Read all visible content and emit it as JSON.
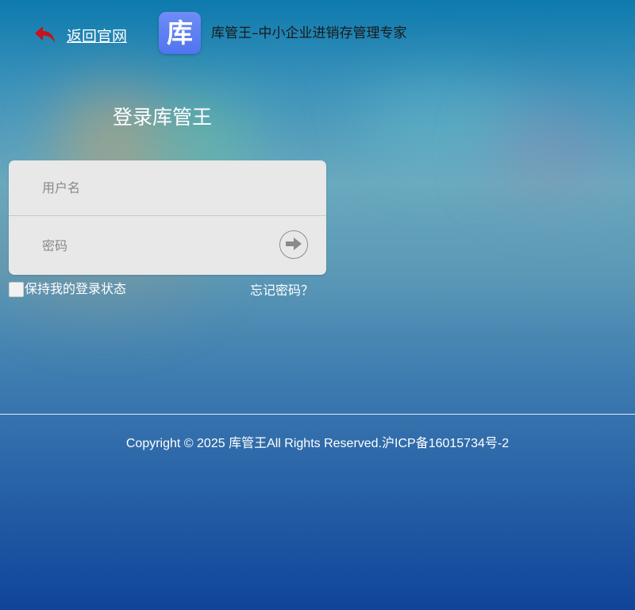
{
  "header": {
    "back_label": "返回官网",
    "logo_char": "库",
    "site_title": "库管王–中小企业进销存管理专家"
  },
  "login": {
    "title": "登录库管王",
    "username_placeholder": "用户名",
    "password_placeholder": "密码",
    "remember_label": "保持我的登录状态",
    "forgot_label": "忘记密码？"
  },
  "footer": {
    "copyright": "Copyright © 2025 库管王All Rights Reserved.沪ICP备16015734号-2"
  },
  "icons": {
    "back": "undo-arrow-icon",
    "submit": "arrow-right-circle-icon"
  },
  "colors": {
    "back_arrow": "#c4141c",
    "logo_bg": "#5c7ef2",
    "login_box_bg": "#e8e8e8"
  }
}
